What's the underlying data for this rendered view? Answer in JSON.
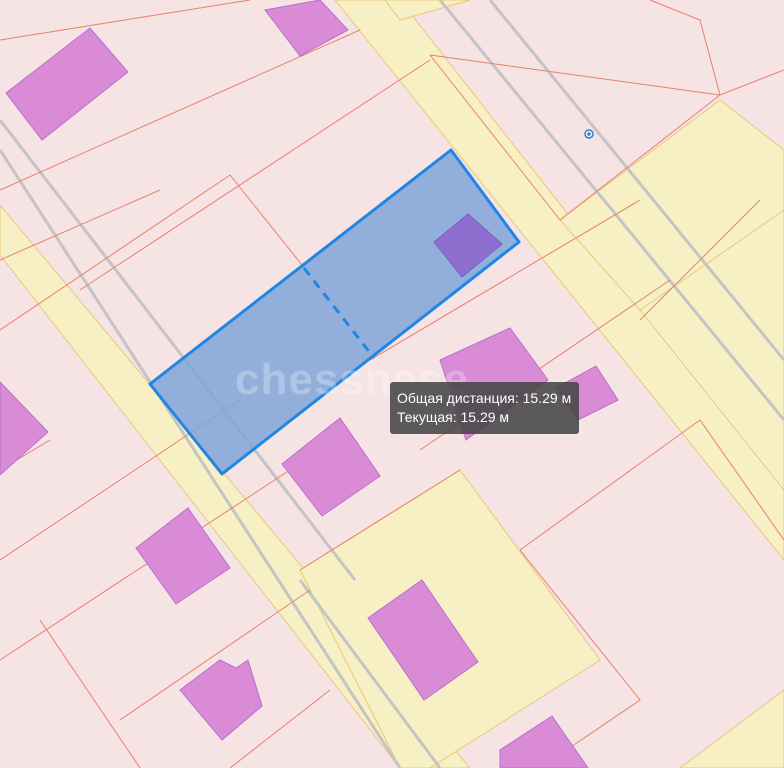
{
  "tooltip": {
    "total_label": "Общая дистанция: 15.29 м",
    "current_label": "Текущая: 15.29 м"
  },
  "watermark_text": "chessnese",
  "colors": {
    "parcel_fill": "#f6e3e4",
    "parcel_border": "#e5826e",
    "road_fill": "#f7f0c4",
    "road_border": "#e8c87a",
    "road_center": "#bcbcbc",
    "building": "#d98bd6",
    "building_border": "#b86fd0",
    "measure_fill": "#7fa6d8",
    "measure_stroke": "#1f86e5",
    "tooltip_bg": "#464646"
  },
  "icons": {
    "marker": "location-dot-icon"
  }
}
